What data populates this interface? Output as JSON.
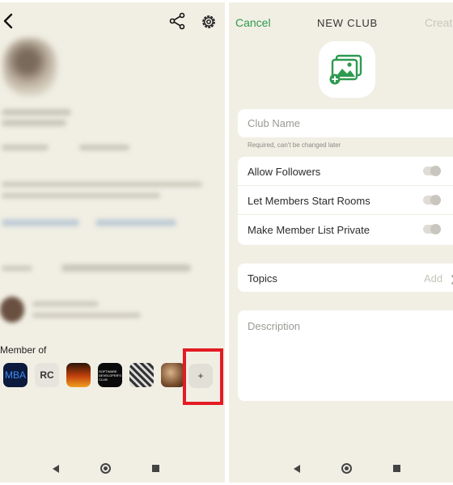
{
  "left_profile": {
    "member_of_label": "Member of",
    "clubs": [
      {
        "name": "club-mba",
        "label": "MBA"
      },
      {
        "name": "club-rc",
        "label": "RC"
      },
      {
        "name": "club-fire",
        "label": ""
      },
      {
        "name": "club-software-developers",
        "label": "SOFTWARE DEVELOPER'S CLUB"
      },
      {
        "name": "club-art",
        "label": ""
      },
      {
        "name": "club-photo",
        "label": ""
      }
    ],
    "add_club_label": "+",
    "highlight_color": "#e31b23"
  },
  "new_club": {
    "cancel_label": "Cancel",
    "title": "NEW CLUB",
    "create_label": "Create",
    "club_name_placeholder": "Club Name",
    "club_name_hint": "Required, can't be changed later",
    "toggles": [
      {
        "label": "Allow Followers",
        "on": false
      },
      {
        "label": "Let Members Start Rooms",
        "on": false
      },
      {
        "label": "Make Member List Private",
        "on": false
      }
    ],
    "topics_label": "Topics",
    "topics_add": "Add",
    "description_placeholder": "Description",
    "accent_color": "#2e9a4f"
  },
  "icons": {
    "back": "back-arrow-icon",
    "share": "share-icon",
    "settings": "gear-icon",
    "add_photo": "add-photo-icon",
    "chevron": "chevron-right-icon"
  }
}
